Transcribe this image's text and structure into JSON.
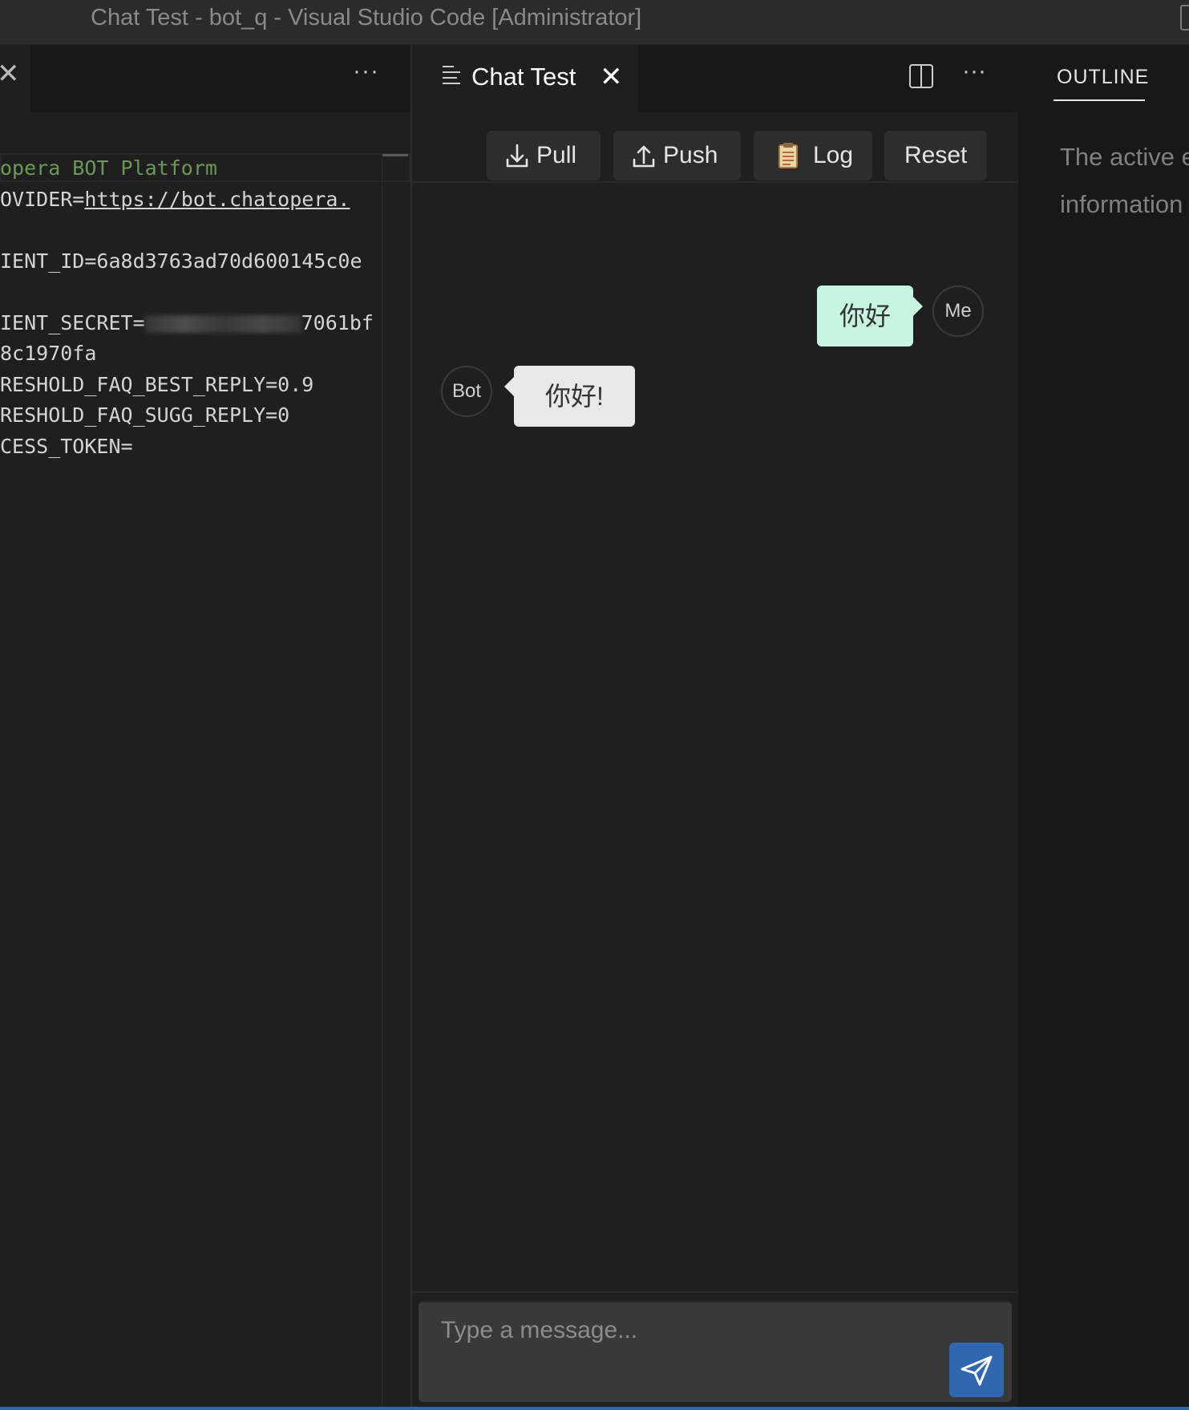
{
  "window": {
    "title": "Chat Test - bot_q - Visual Studio Code [Administrator]"
  },
  "left_editor": {
    "more_label": "···",
    "code_lines": [
      {
        "text": "opera BOT Platform",
        "kind": "comment"
      },
      {
        "prefix": "OVIDER=",
        "link": "https://bot.chatopera.",
        "kind": "url"
      },
      {
        "text": "",
        "kind": "blank"
      },
      {
        "text": "IENT_ID=6a8d3763ad70d600145c0e",
        "kind": "plain"
      },
      {
        "text": "",
        "kind": "blank"
      },
      {
        "prefix": "IENT_SECRET=",
        "suffix": "7061bf",
        "kind": "secret"
      },
      {
        "text": "8c1970fa",
        "kind": "plain"
      },
      {
        "text": "RESHOLD_FAQ_BEST_REPLY=0.9",
        "kind": "plain"
      },
      {
        "text": "RESHOLD_FAQ_SUGG_REPLY=0",
        "kind": "plain"
      },
      {
        "text": "CESS_TOKEN=",
        "kind": "plain"
      }
    ]
  },
  "chat_panel": {
    "tab_label": "Chat Test",
    "more_label": "···",
    "toolbar": {
      "pull_label": "Pull",
      "push_label": "Push",
      "log_label": "Log",
      "reset_label": "Reset"
    },
    "messages": [
      {
        "sender": "Me",
        "text": "你好"
      },
      {
        "sender": "Bot",
        "text": "你好!"
      }
    ],
    "input": {
      "placeholder": "Type a message...",
      "value": ""
    },
    "colors": {
      "me_bubble": "#c6f6e0",
      "bot_bubble": "#e8e8e8",
      "send_button": "#2f68b0"
    }
  },
  "outline": {
    "header": "OUTLINE",
    "line1": "The active e",
    "line2": "information"
  }
}
